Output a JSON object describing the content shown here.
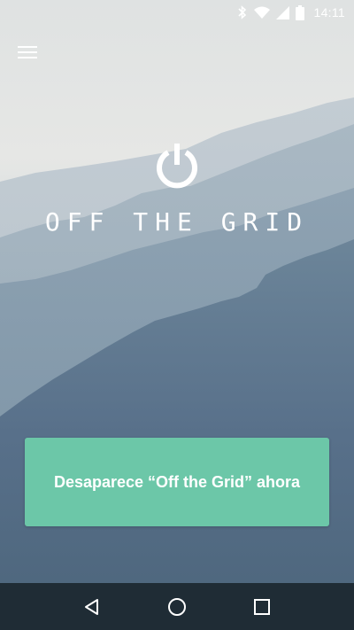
{
  "app": {
    "title": "OFF THE GRID"
  },
  "status_bar": {
    "time": "14:11",
    "icons": [
      "bluetooth-icon",
      "wifi-icon",
      "signal-icon",
      "battery-icon"
    ]
  },
  "menu": {
    "icon": "hamburger-menu-icon"
  },
  "cta": {
    "label": "Desaparece “Off the Grid” ahora"
  },
  "nav_bar": {
    "buttons": [
      "back-icon",
      "home-icon",
      "recents-icon"
    ]
  },
  "colors": {
    "accent": "#6cc7a8",
    "nav_bar": "#1f2c35",
    "sky_top": "#e4e6e5",
    "mountain_far": "#a7b6c2",
    "mountain_near": "#4e677c"
  }
}
